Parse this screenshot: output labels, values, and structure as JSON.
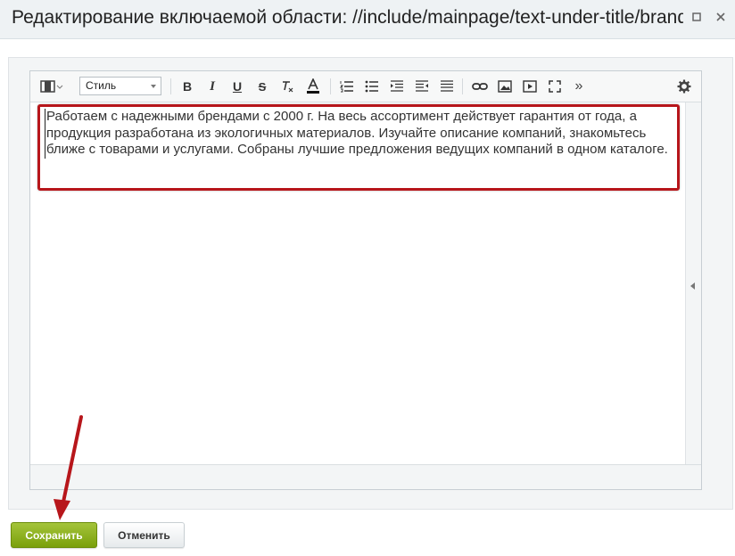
{
  "window": {
    "title": "Редактирование включаемой области: //include/mainpage/text-under-title/brands-list.php",
    "controls": [
      "maximize-icon",
      "close-icon"
    ]
  },
  "toolbar": {
    "style_label": "Стиль",
    "buttons": [
      "film-icon",
      "bold-icon",
      "italic-icon",
      "underline-icon",
      "strikethrough-icon",
      "clear-format-icon",
      "text-color-icon",
      "ordered-list-icon",
      "unordered-list-icon",
      "outdent-icon",
      "indent-icon",
      "align-icon",
      "link-icon",
      "image-icon",
      "video-icon",
      "fullscreen-icon",
      "more-icon",
      "settings-icon"
    ]
  },
  "editor": {
    "content": "Работаем с надежными брендами с 2000 г. На весь ассортимент действует гарантия от года, а продукция разработана из экологичных материалов. Изучайте описание компаний, знакомьтесь ближе с товарами и услугами. Собраны лучшие предложения ведущих компаний в одном каталоге."
  },
  "footer": {
    "save_label": "Сохранить",
    "cancel_label": "Отменить"
  },
  "colors": {
    "highlight": "#b7161b",
    "save_button": "#8db21c"
  }
}
